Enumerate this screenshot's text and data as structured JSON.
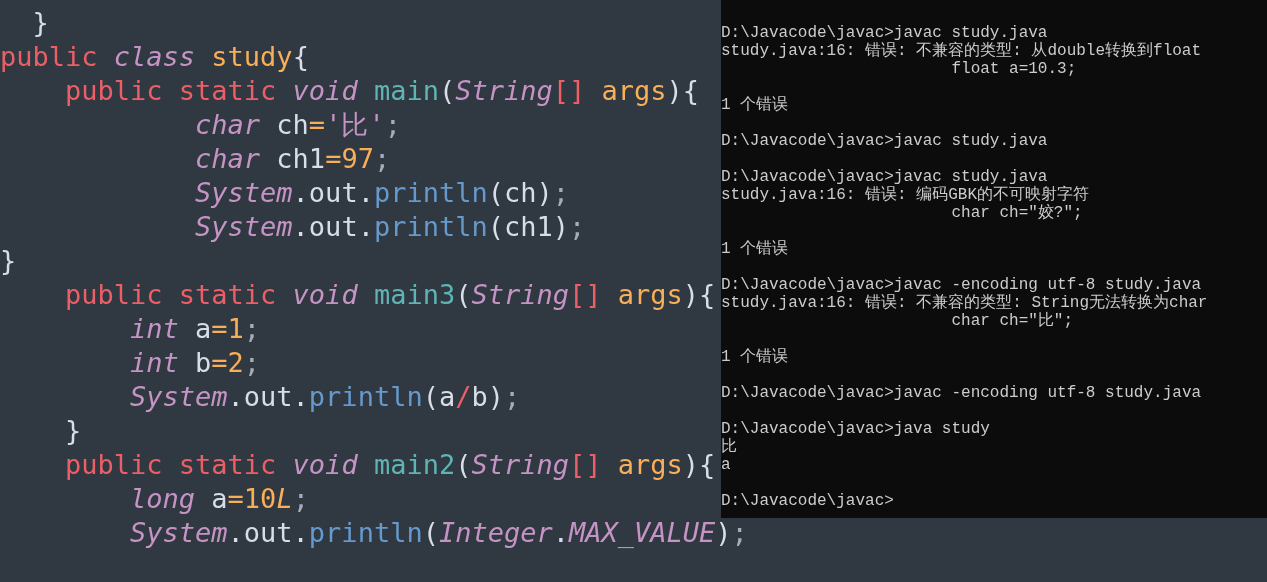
{
  "editor": {
    "lines": [
      [
        {
          "kind": "p",
          "text": "  }"
        }
      ],
      [
        {
          "kind": "kw",
          "text": "public "
        },
        {
          "kind": "ty",
          "text": "class "
        },
        {
          "kind": "cls",
          "text": "study"
        },
        {
          "kind": "p",
          "text": "{"
        }
      ],
      [
        {
          "kind": "kw",
          "text": "    public static "
        },
        {
          "kind": "ty",
          "text": "void "
        },
        {
          "kind": "fn",
          "text": "main"
        },
        {
          "kind": "p",
          "text": "("
        },
        {
          "kind": "ty",
          "text": "String"
        },
        {
          "kind": "op",
          "text": "[]"
        },
        {
          "kind": "cls",
          "text": " args"
        },
        {
          "kind": "p",
          "text": "){"
        }
      ],
      [
        {
          "kind": "ty",
          "text": "            char "
        },
        {
          "kind": "p",
          "text": "ch"
        },
        {
          "kind": "num",
          "text": "="
        },
        {
          "kind": "str",
          "text": "'比'"
        },
        {
          "kind": "dim",
          "text": ";"
        }
      ],
      [
        {
          "kind": "ty",
          "text": "            char "
        },
        {
          "kind": "p",
          "text": "ch1"
        },
        {
          "kind": "num",
          "text": "=97"
        },
        {
          "kind": "dim",
          "text": ";"
        }
      ],
      [
        {
          "kind": "ty",
          "text": "            System"
        },
        {
          "kind": "p",
          "text": ".out."
        },
        {
          "kind": "me",
          "text": "println"
        },
        {
          "kind": "p",
          "text": "(ch)"
        },
        {
          "kind": "dim",
          "text": ";"
        }
      ],
      [
        {
          "kind": "ty",
          "text": "            System"
        },
        {
          "kind": "p",
          "text": ".out."
        },
        {
          "kind": "me",
          "text": "println"
        },
        {
          "kind": "p",
          "text": "(ch1)"
        },
        {
          "kind": "dim",
          "text": ";"
        }
      ],
      [
        {
          "kind": "p",
          "text": "}"
        }
      ],
      [
        {
          "kind": "kw",
          "text": "    public static "
        },
        {
          "kind": "ty",
          "text": "void "
        },
        {
          "kind": "fn",
          "text": "main3"
        },
        {
          "kind": "p",
          "text": "("
        },
        {
          "kind": "ty",
          "text": "String"
        },
        {
          "kind": "op",
          "text": "[]"
        },
        {
          "kind": "cls",
          "text": " args"
        },
        {
          "kind": "p",
          "text": "){"
        }
      ],
      [
        {
          "kind": "ty",
          "text": "        int "
        },
        {
          "kind": "p",
          "text": "a"
        },
        {
          "kind": "num",
          "text": "=1"
        },
        {
          "kind": "dim",
          "text": ";"
        }
      ],
      [
        {
          "kind": "ty",
          "text": "        int "
        },
        {
          "kind": "p",
          "text": "b"
        },
        {
          "kind": "num",
          "text": "=2"
        },
        {
          "kind": "dim",
          "text": ";"
        }
      ],
      [
        {
          "kind": "ty",
          "text": "        System"
        },
        {
          "kind": "p",
          "text": ".out."
        },
        {
          "kind": "me",
          "text": "println"
        },
        {
          "kind": "p",
          "text": "(a"
        },
        {
          "kind": "op",
          "text": "/"
        },
        {
          "kind": "p",
          "text": "b)"
        },
        {
          "kind": "dim",
          "text": ";"
        }
      ],
      [
        {
          "kind": "p",
          "text": "    }"
        }
      ],
      [
        {
          "kind": "kw",
          "text": "    public static "
        },
        {
          "kind": "ty",
          "text": "void "
        },
        {
          "kind": "fn",
          "text": "main2"
        },
        {
          "kind": "p",
          "text": "("
        },
        {
          "kind": "ty",
          "text": "String"
        },
        {
          "kind": "op",
          "text": "[]"
        },
        {
          "kind": "cls",
          "text": " args"
        },
        {
          "kind": "p",
          "text": "){"
        }
      ],
      [
        {
          "kind": "ty",
          "text": "        long "
        },
        {
          "kind": "p",
          "text": "a"
        },
        {
          "kind": "num",
          "text": "=10"
        },
        {
          "kind": "numi",
          "text": "L"
        },
        {
          "kind": "dim",
          "text": ";"
        }
      ],
      [
        {
          "kind": "ty",
          "text": "        System"
        },
        {
          "kind": "p",
          "text": ".out."
        },
        {
          "kind": "me",
          "text": "println"
        },
        {
          "kind": "p",
          "text": "("
        },
        {
          "kind": "ty",
          "text": "Integer"
        },
        {
          "kind": "p",
          "text": "."
        },
        {
          "kind": "ty",
          "text": "MAX_VALUE"
        },
        {
          "kind": "p",
          "text": ")"
        },
        {
          "kind": "dim",
          "text": ";"
        }
      ]
    ]
  },
  "terminal": {
    "blocks": [
      [
        "D:\\Javacode\\javac>javac study.java",
        "study.java:16: 错误: 不兼容的类型: 从double转换到float",
        "                        float a=10.3;"
      ],
      [
        "1 个错误"
      ],
      [
        "D:\\Javacode\\javac>javac study.java"
      ],
      [
        "D:\\Javacode\\javac>javac study.java",
        "study.java:16: 错误: 编码GBK的不可映射字符",
        "                        char ch=\"姣?\";"
      ],
      [
        "1 个错误"
      ],
      [
        "D:\\Javacode\\javac>javac -encoding utf-8 study.java",
        "study.java:16: 错误: 不兼容的类型: String无法转换为char",
        "                        char ch=\"比\";"
      ],
      [
        "1 个错误"
      ],
      [
        "D:\\Javacode\\javac>javac -encoding utf-8 study.java"
      ],
      [
        "D:\\Javacode\\javac>java study",
        "比",
        "a"
      ],
      [
        "D:\\Javacode\\javac>"
      ]
    ]
  }
}
